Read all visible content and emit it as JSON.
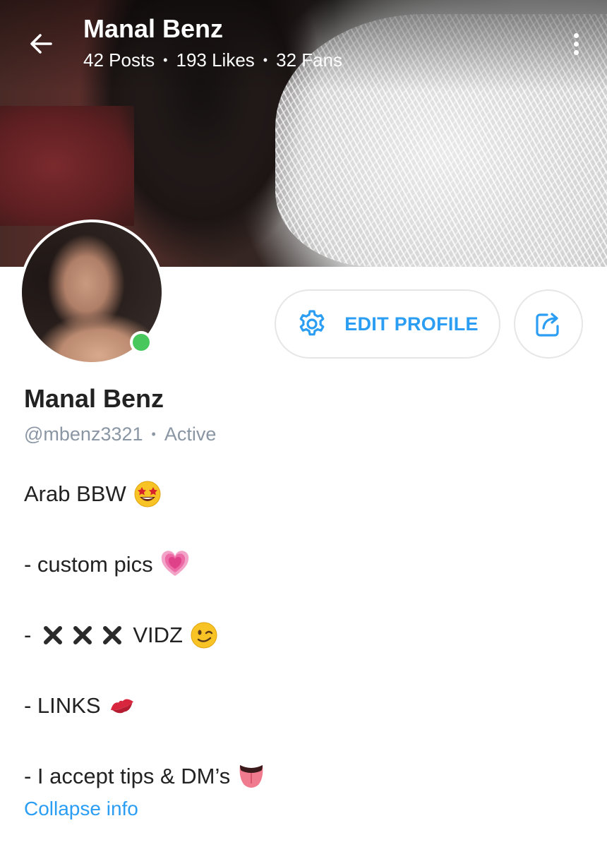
{
  "header": {
    "title": "Manal Benz",
    "stats": {
      "posts": "42 Posts",
      "likes": "193 Likes",
      "fans": "32 Fans",
      "separator": "•"
    },
    "back_icon": "arrow-left-icon",
    "more_icon": "more-vertical-icon"
  },
  "profile": {
    "display_name": "Manal Benz",
    "handle": "@mbenz3321",
    "separator": "•",
    "status": "Active",
    "online": true
  },
  "actions": {
    "edit_label": "EDIT PROFILE",
    "edit_icon": "gear-icon",
    "share_icon": "share-icon"
  },
  "bio": {
    "line1": "Arab BBW",
    "line2": "- custom pics",
    "line3_prefix": "-",
    "line3_suffix": "VIDZ",
    "line4": "- LINKS",
    "line5": "- I accept tips & DM’s"
  },
  "collapse_label": "Collapse info",
  "colors": {
    "accent": "#2b9ef3",
    "muted": "#8a96a3",
    "online": "#48c85c"
  }
}
